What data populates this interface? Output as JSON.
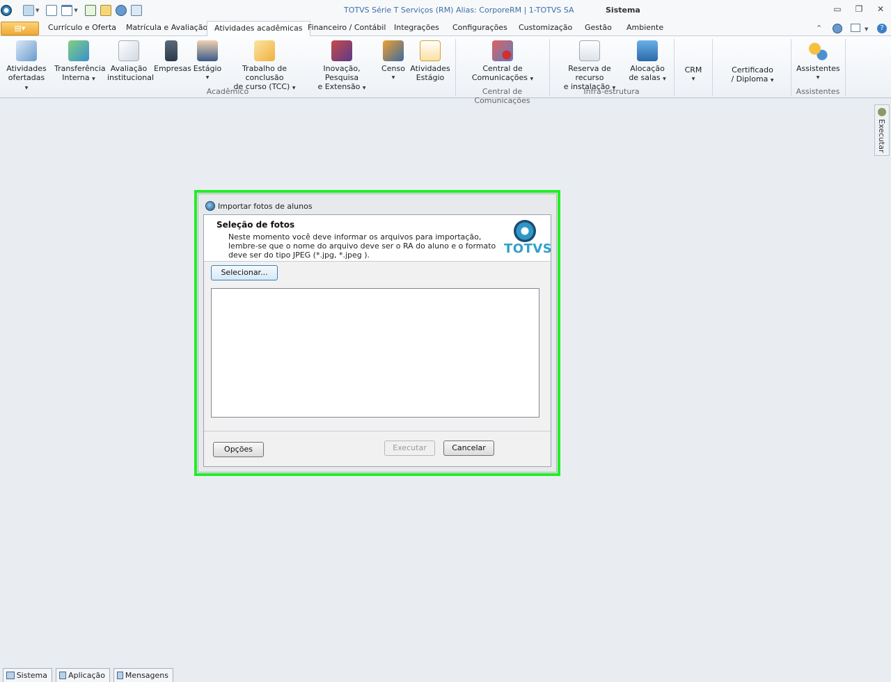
{
  "window": {
    "title": "TOTVS Série T Serviços (RM) Alias: CorporeRM | 1-TOTVS SA",
    "context": "Sistema"
  },
  "tabs": [
    "Currículo e Oferta",
    "Matrícula e Avaliação",
    "Atividades acadêmicas",
    "Financeiro / Contábil",
    "Integrações",
    "Configurações",
    "Customização",
    "Gestão",
    "Ambiente"
  ],
  "active_tab": "Atividades acadêmicas",
  "ribbon": {
    "buttons": [
      {
        "line1": "Atividades",
        "line2": "ofertadas"
      },
      {
        "line1": "Transferência",
        "line2": "Interna"
      },
      {
        "line1": "Avaliação",
        "line2": "institucional"
      },
      {
        "line1": "Empresas",
        "line2": ""
      },
      {
        "line1": "Estágio",
        "line2": ""
      },
      {
        "line1": "Trabalho de conclusão",
        "line2": "de curso (TCC)"
      },
      {
        "line1": "Inovação, Pesquisa",
        "line2": "e Extensão"
      },
      {
        "line1": "Censo",
        "line2": ""
      },
      {
        "line1": "Atividades",
        "line2": "Estágio"
      },
      {
        "line1": "Central de",
        "line2": "Comunicações"
      },
      {
        "line1": "Reserva de recurso",
        "line2": "e instalação"
      },
      {
        "line1": "Alocação",
        "line2": "de salas"
      },
      {
        "line1": "CRM",
        "line2": ""
      },
      {
        "line1": "Certificado",
        "line2": "/ Diploma"
      },
      {
        "line1": "Assistentes",
        "line2": ""
      }
    ],
    "groups": [
      "Acadêmico",
      "Central de Comunicações",
      "Infra-estrutura",
      "Assistentes"
    ]
  },
  "side_panel": {
    "label": "Executar"
  },
  "dialog": {
    "title": "Importar fotos de alunos",
    "header_title": "Seleção de fotos",
    "header_desc": "Neste momento você deve informar os arquivos para importação, lembre-se que o nome do arquivo deve ser o RA do aluno e o formato deve ser do tipo JPEG (*.jpg, *.jpeg ).",
    "logo_text": "TOTVS",
    "select_button": "Selecionar...",
    "options_button": "Opções",
    "execute_button": "Executar",
    "cancel_button": "Cancelar"
  },
  "bottom_tabs": [
    "Sistema",
    "Aplicação",
    "Mensagens"
  ],
  "colors": {
    "accent_orange": "#f0a830",
    "highlight_outline": "#22ee22",
    "logo_blue": "#2fa0cc"
  }
}
